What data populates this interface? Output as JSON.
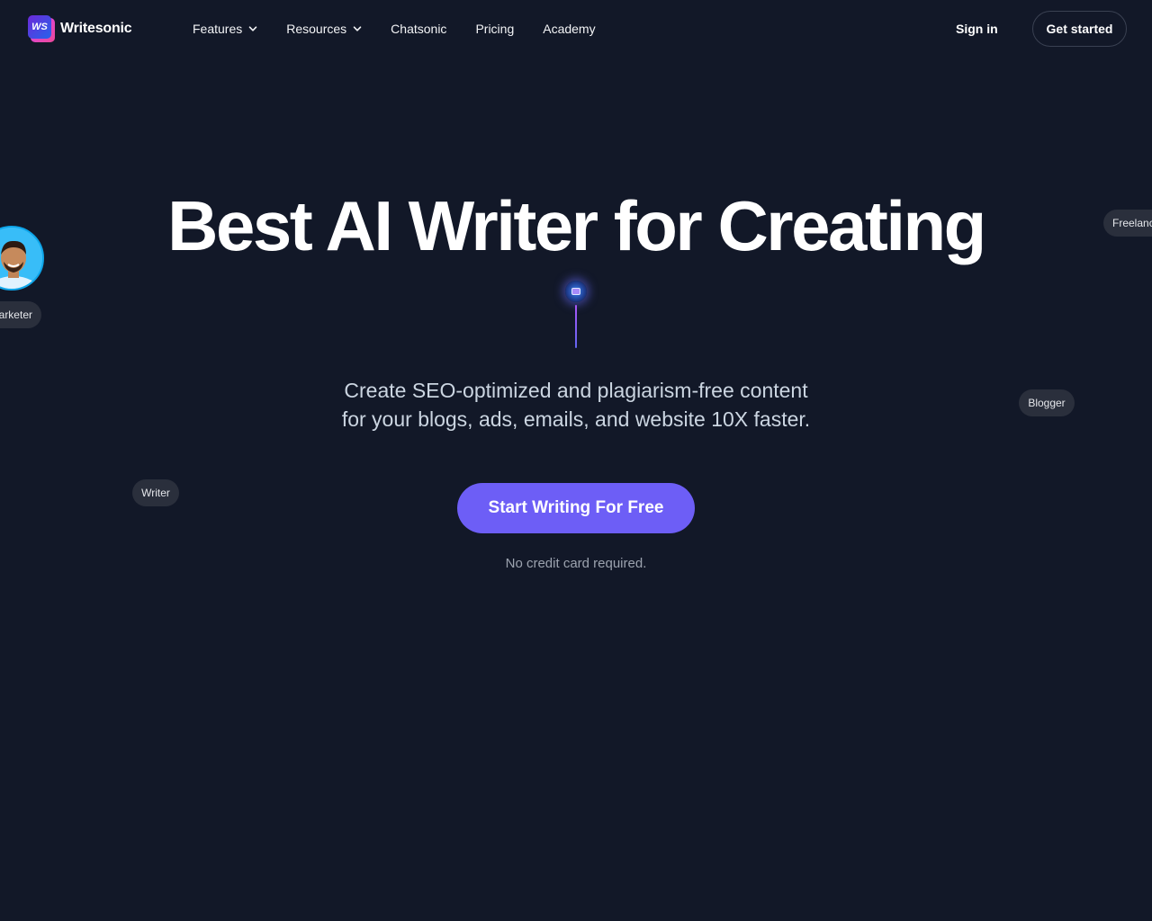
{
  "header": {
    "logo_text": "Writesonic",
    "logo_badge": "WS",
    "nav": [
      {
        "label": "Features",
        "dropdown": true
      },
      {
        "label": "Resources",
        "dropdown": true
      },
      {
        "label": "Chatsonic",
        "dropdown": false
      },
      {
        "label": "Pricing",
        "dropdown": false
      },
      {
        "label": "Academy",
        "dropdown": false
      }
    ],
    "sign_in": "Sign in",
    "get_started": "Get started"
  },
  "hero": {
    "title": "Best AI Writer for Creating",
    "subtitle_line1": "Create SEO-optimized and plagiarism-free content",
    "subtitle_line2": "for your blogs, ads, emails, and website 10X faster.",
    "cta": "Start Writing For Free",
    "note": "No credit card required."
  },
  "tags": {
    "marketer": "arketer",
    "writer": "Writer",
    "blogger": "Blogger",
    "freelancer": "Freelanc"
  },
  "colors": {
    "background": "#121828",
    "accent": "#6d5ef6",
    "tag_bg": "#2a2f3c"
  }
}
